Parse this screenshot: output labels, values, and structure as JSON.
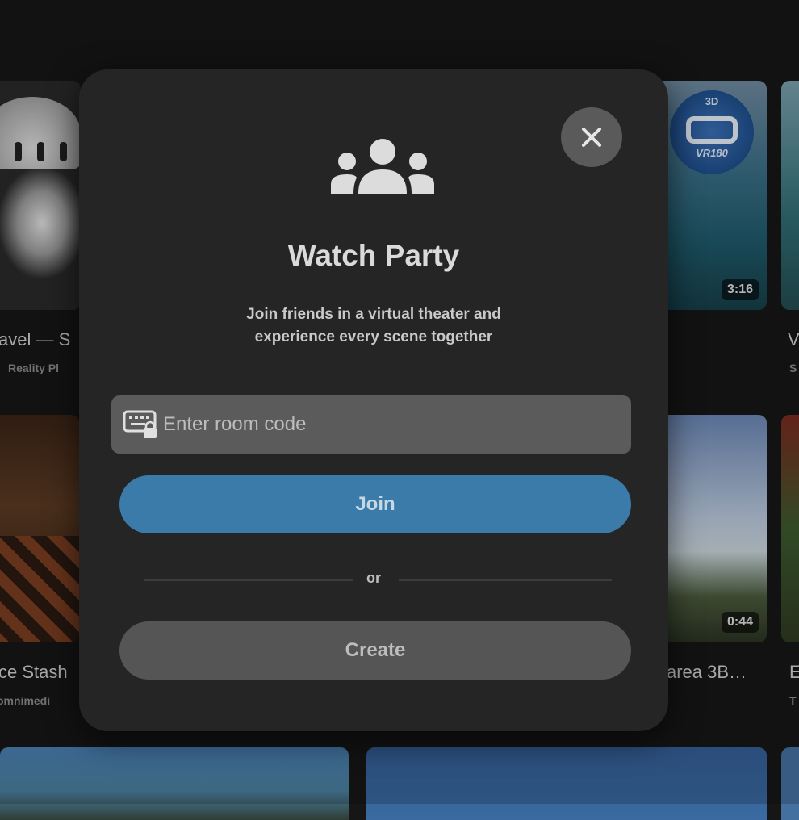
{
  "background_cards": [
    {
      "title": "avel — S",
      "subtitle": "Reality Pl"
    },
    {
      "duration": "3:16"
    },
    {
      "title": "V",
      "subtitle": "S"
    },
    {
      "title": "ce Stash",
      "subtitle": "omnimedi"
    },
    {
      "title": "area 3B…",
      "duration": "0:44"
    },
    {
      "title": "E",
      "subtitle": "T"
    }
  ],
  "thumbnail_badge": {
    "text": "VR180",
    "top_text": "3D"
  },
  "modal": {
    "title": "Watch Party",
    "description": "Join friends in a virtual theater and experience every scene together",
    "room_code_placeholder": "Enter room code",
    "join_label": "Join",
    "or_label": "or",
    "create_label": "Create",
    "icons": {
      "header": "group-icon",
      "close": "close-icon",
      "field": "keyboard-lock-icon"
    }
  }
}
